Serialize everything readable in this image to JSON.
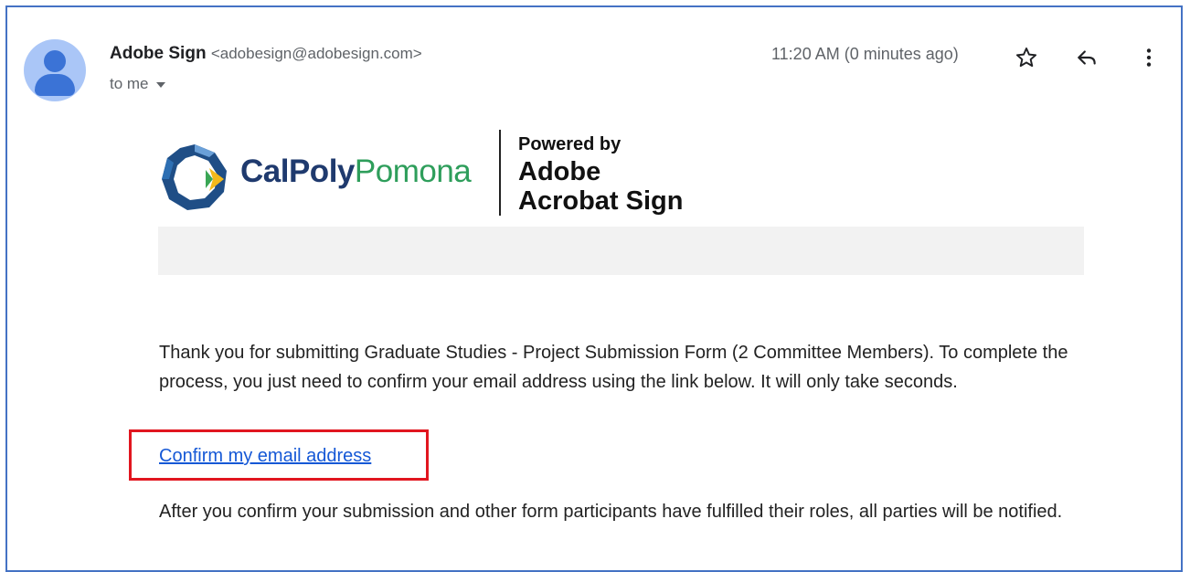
{
  "header": {
    "sender_name": "Adobe Sign",
    "sender_email": "<adobesign@adobesign.com>",
    "recipient": "to me",
    "timestamp": "11:20 AM (0 minutes ago)"
  },
  "icons": {
    "avatar": "person-avatar-icon",
    "star": "star-icon",
    "reply": "reply-icon",
    "more": "more-vertical-icon",
    "recipient_caret": "caret-down-icon"
  },
  "branding": {
    "logo_text_primary": "CalPoly",
    "logo_text_secondary": "Pomona",
    "powered_line1": "Powered by",
    "powered_line2": "Adobe",
    "powered_line3": "Acrobat Sign"
  },
  "message": {
    "body": "Thank you for submitting Graduate Studies - Project Submission Form (2 Committee Members). To complete the process, you just need to confirm your email address using the link below. It will only take seconds.",
    "confirm_link": "Confirm my email address",
    "after": "After you confirm your submission and other form participants have fulfilled their roles, all parties will be notified."
  },
  "colors": {
    "highlight_border": "#e1161f",
    "link": "#1558d6",
    "frame_border": "#4472c4",
    "logo_navy": "#1f3a6e",
    "logo_green": "#2e9e5b"
  }
}
